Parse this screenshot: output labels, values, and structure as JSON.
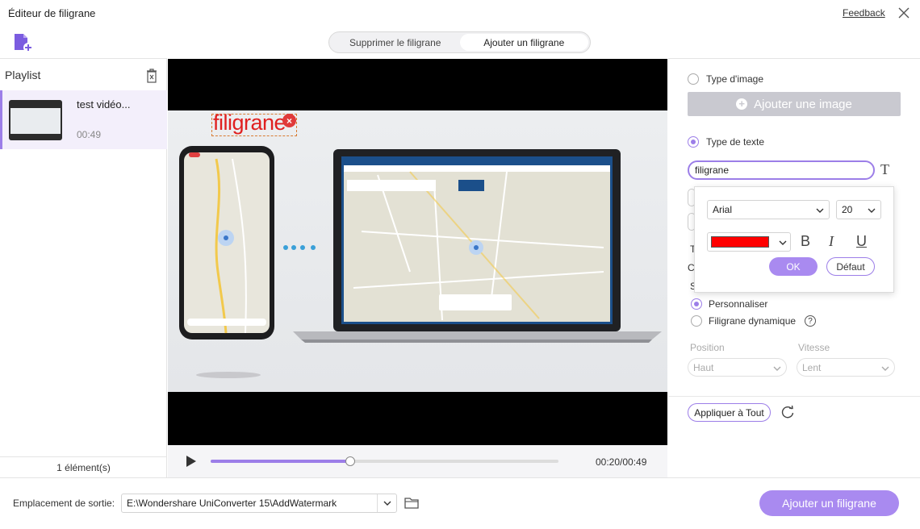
{
  "window": {
    "title": "Éditeur de filigrane",
    "feedback_label": "Feedback"
  },
  "mode_tabs": [
    {
      "label": "Supprimer le filigrane",
      "active": false
    },
    {
      "label": "Ajouter un filigrane",
      "active": true
    }
  ],
  "playlist": {
    "label": "Playlist",
    "items": [
      {
        "name": "test vidéo...",
        "duration": "00:49"
      }
    ],
    "footer": "1 élément(s)"
  },
  "player": {
    "time": "00:20/00:49",
    "progress": 0.4
  },
  "watermark": {
    "text": "filigrane",
    "color": "#ff0000"
  },
  "settings": {
    "image_type_label": "Type d'image",
    "add_image_label": "Ajouter une image",
    "text_type_label": "Type de texte",
    "text_value": "filigrane",
    "font_popup": {
      "font": "Arial",
      "size": "20",
      "color": "#ff0000",
      "bold_label": "B",
      "italic_label": "I",
      "underline_label": "U",
      "ok_label": "OK",
      "default_label": "Défaut"
    },
    "custom_label": "Personnaliser",
    "dynamic_label": "Filigrane dynamique",
    "position_label": "Position",
    "speed_label": "Vitesse",
    "position_value": "Haut",
    "speed_value": "Lent",
    "apply_all_label": "Appliquer à Tout"
  },
  "bottom": {
    "output_label": "Emplacement de sortie:",
    "output_path": "E:\\Wondershare UniConverter 15\\AddWatermark",
    "add_watermark_label": "Ajouter un filigrane"
  },
  "colors": {
    "accent": "#9c7ee8",
    "button": "#a98af0"
  }
}
